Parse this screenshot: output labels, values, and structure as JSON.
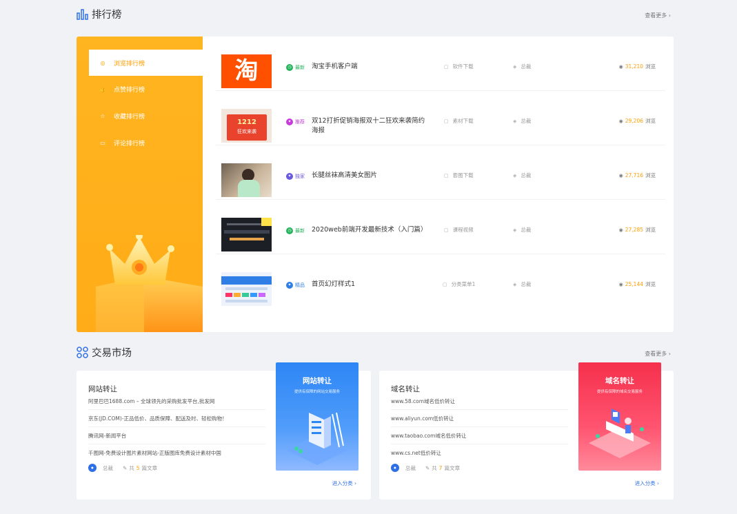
{
  "ranking": {
    "title": "排行榜",
    "more": "查看更多 ›",
    "tabs": [
      {
        "label": "浏览排行榜",
        "icon": "◎"
      },
      {
        "label": "点赞排行榜",
        "icon": "👍"
      },
      {
        "label": "收藏排行榜",
        "icon": "☆"
      },
      {
        "label": "评论排行榜",
        "icon": "▭"
      }
    ],
    "items": [
      {
        "badge": "最新",
        "title": "淘宝手机客户端",
        "category": "软件下载",
        "author": "总裁",
        "views": "31,210",
        "views_label": "浏览"
      },
      {
        "badge": "推荐",
        "title": "双12打折促销海报双十二狂欢来袭简约海报",
        "category": "素材下载",
        "author": "总裁",
        "views": "29,206",
        "views_label": "浏览"
      },
      {
        "badge": "独家",
        "title": "长腿丝袜高清美女图片",
        "category": "套图下载",
        "author": "总裁",
        "views": "27,716",
        "views_label": "浏览"
      },
      {
        "badge": "最新",
        "title": "2020web前端开发最新技术（入门篇）",
        "category": "课程视频",
        "author": "总裁",
        "views": "27,285",
        "views_label": "浏览"
      },
      {
        "badge": "精品",
        "title": "首页幻灯样式1",
        "category": "分类菜单1",
        "author": "总裁",
        "views": "25,144",
        "views_label": "浏览"
      }
    ],
    "thumb_text": {
      "t1": "淘",
      "t2": "1212",
      "t2b": "狂欢来袭"
    }
  },
  "market": {
    "title": "交易市场",
    "more": "查看更多 ›",
    "cards": [
      {
        "title": "网站转让",
        "items": [
          "阿里巴巴1688.com – 全球领先的采购批发平台,批发网",
          "京东(JD.COM)-正品低价、品质保障、配送及时、轻松购物！",
          "腾讯网-新闻平台",
          "千图网-免费设计图片素材网站-正版图库免费设计素材中国"
        ],
        "author": "总裁",
        "count_pre": "共",
        "count": "5",
        "count_post": "篇文章",
        "enter": "进入分类 ›",
        "banner_title": "网站转让",
        "banner_sub": "提供有保障的网站交易服务"
      },
      {
        "title": "域名转让",
        "items": [
          "www.58.com域名低价转让",
          "www.aliyun.com低价转让",
          "www.taobao.com域名低价转让",
          "www.cs.net低价转让"
        ],
        "author": "总裁",
        "count_pre": "共",
        "count": "7",
        "count_post": "篇文章",
        "enter": "进入分类 ›",
        "banner_title": "域名转让",
        "banner_sub": "提供有保障的域名交易服务"
      }
    ]
  },
  "colors": {
    "accent": "#ff9d00",
    "blue": "#2f6fe5",
    "red": "#f5304c"
  }
}
